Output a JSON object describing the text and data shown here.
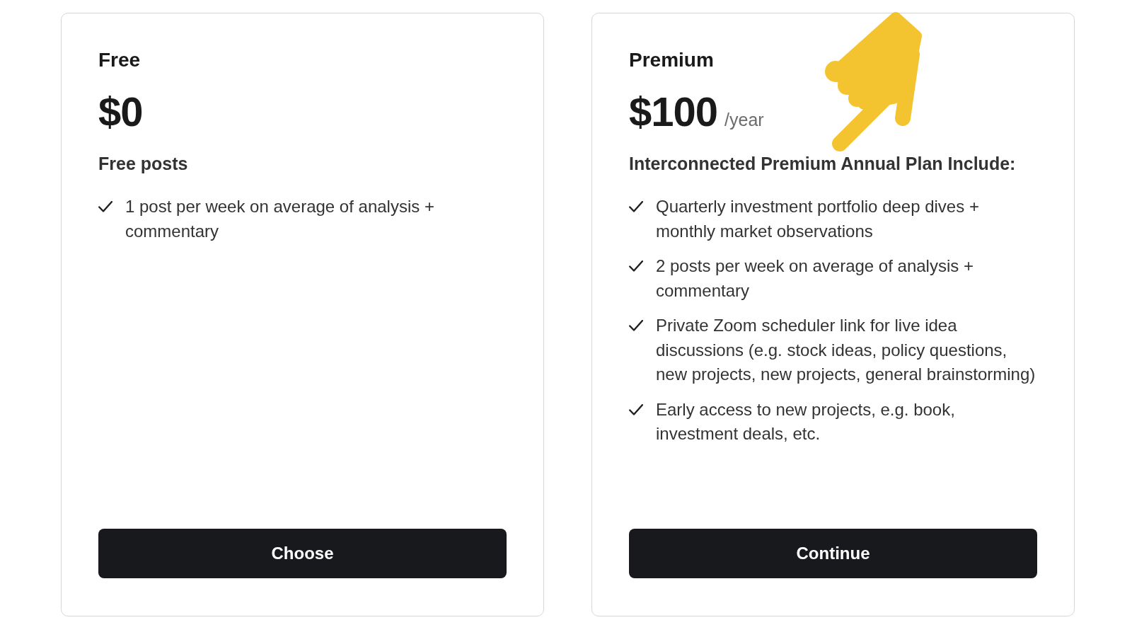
{
  "plans": [
    {
      "name": "Free",
      "price": "$0",
      "subtitle": "Free posts",
      "features": [
        "1 post per week on average of analysis + commentary"
      ],
      "button": "Choose"
    },
    {
      "name": "Premium",
      "price": "$100",
      "period": "/year",
      "subtitle": "Interconnected Premium Annual Plan Include:",
      "features": [
        "Quarterly investment portfolio deep dives + monthly market observations",
        "2 posts per week on average of analysis + commentary",
        "Private Zoom scheduler link for live idea discussions (e.g. stock ideas, policy questions, new projects, new projects, general brainstorming)",
        "Early access to new projects, e.g. book, investment deals, etc."
      ],
      "button": "Continue"
    }
  ]
}
